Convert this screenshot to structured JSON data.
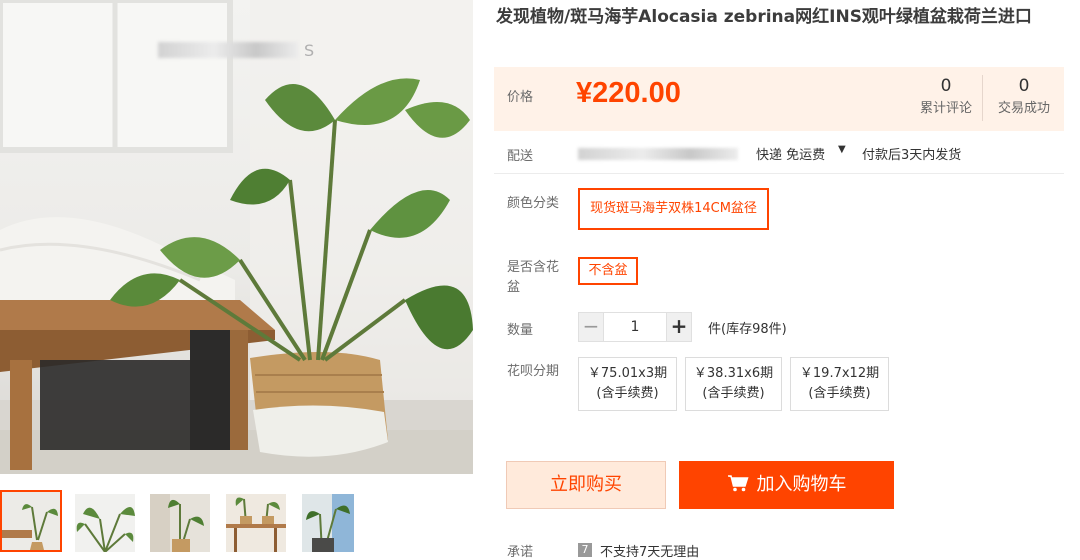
{
  "product": {
    "title": "发现植物/斑马海芋Alocasia zebrina网红INS观叶绿植盆栽荷兰进口",
    "image_watermark": "S"
  },
  "price": {
    "label": "价格",
    "value": "¥220.00",
    "reviews_count": "0",
    "reviews_label": "累计评论",
    "sales_count": "0",
    "sales_label": "交易成功"
  },
  "delivery": {
    "label": "配送",
    "method": "快递 免运费",
    "ship_time": "付款后3天内发货"
  },
  "color": {
    "label": "颜色分类",
    "selected": "现货斑马海芋双株14CM盆径"
  },
  "pot": {
    "label": "是否含花盆",
    "selected": "不含盆"
  },
  "quantity": {
    "label": "数量",
    "minus": "−",
    "value": "1",
    "plus": "+",
    "stock": "件(库存98件)"
  },
  "installments": {
    "label": "花呗分期",
    "options": [
      {
        "amount": "￥75.01x3期",
        "fee": "(含手续费)"
      },
      {
        "amount": "￥38.31x6期",
        "fee": "(含手续费)"
      },
      {
        "amount": "￥19.7x12期",
        "fee": "(含手续费)"
      }
    ]
  },
  "actions": {
    "buy_now": "立即购买",
    "add_to_cart": "加入购物车"
  },
  "promise": {
    "label": "承诺",
    "text": "不支持7天无理由"
  },
  "colors": {
    "accent": "#ff4400",
    "price_bg": "#fff2e8",
    "buy_now_bg": "#ffeadb"
  },
  "icons": [
    "chevron-down-icon",
    "cart-icon",
    "no-return-icon"
  ]
}
